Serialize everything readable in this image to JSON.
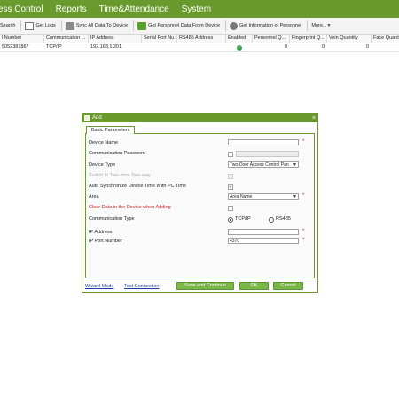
{
  "menubar": {
    "items": [
      "ess Control",
      "Reports",
      "Time&Attendance",
      "System"
    ]
  },
  "toolbar": {
    "items": [
      {
        "label": "Search",
        "icon": "search-icon"
      },
      {
        "label": "Get Logs",
        "icon": "logs-icon"
      },
      {
        "label": "Sync All Data To Device",
        "icon": "sync-icon"
      },
      {
        "label": "Get Personnel Data From Device",
        "icon": "download-icon"
      },
      {
        "label": "Get Information of Personnel",
        "icon": "personnel-icon"
      },
      {
        "label": "More...",
        "icon": "more-icon"
      }
    ]
  },
  "table": {
    "columns": [
      "l Number",
      "Communication ...",
      "IP Address",
      "Serial Port Nu...",
      "RS485 Address",
      "Enabled",
      "Personnel Q...",
      "Fingerprint Q...",
      "Vein Quantity",
      "Face Quantit"
    ],
    "row": {
      "serial": "5052381867",
      "communication": "TCP/IP",
      "ip": "192.168.1.201",
      "personnel": "0",
      "fingerprint": "0",
      "vein": "0"
    }
  },
  "dialog": {
    "title": "Add",
    "tab": "Basic Parameters",
    "labels": {
      "device_name": "Device Name",
      "comm_password": "Communication Password",
      "device_type": "Device Type",
      "switch_two_door": "Switch to Two-door Two-way",
      "auto_sync": "Auto Synchronize Device Time With PC Time",
      "area": "Area",
      "clear_data": "Clear Data in the Device when Adding",
      "comm_type": "Communication Type",
      "ip_address": "IP Address",
      "ip_port": "IP Port Number"
    },
    "values": {
      "device_name": "",
      "comm_password": "",
      "device_type": "Two-Door Access Control Pan",
      "area": "Area Name",
      "ip_address": "",
      "ip_port": "4370"
    },
    "radio": {
      "tcpip": "TCP/IP",
      "rs485": "RS485"
    },
    "required_mark": "*",
    "links": {
      "wizard": "Wizard Mode",
      "test": "Test Connection"
    },
    "buttons": {
      "save_continue": "Save and Continue",
      "ok": "OK",
      "cancel": "Cancel"
    },
    "close_glyph": "×",
    "checkbox_glyph": "✓"
  },
  "colors": {
    "brand_green": "#6a9a2e",
    "button_green": "#7ab648",
    "error_red": "#d21f1f",
    "link_blue": "#1f3fa8"
  }
}
